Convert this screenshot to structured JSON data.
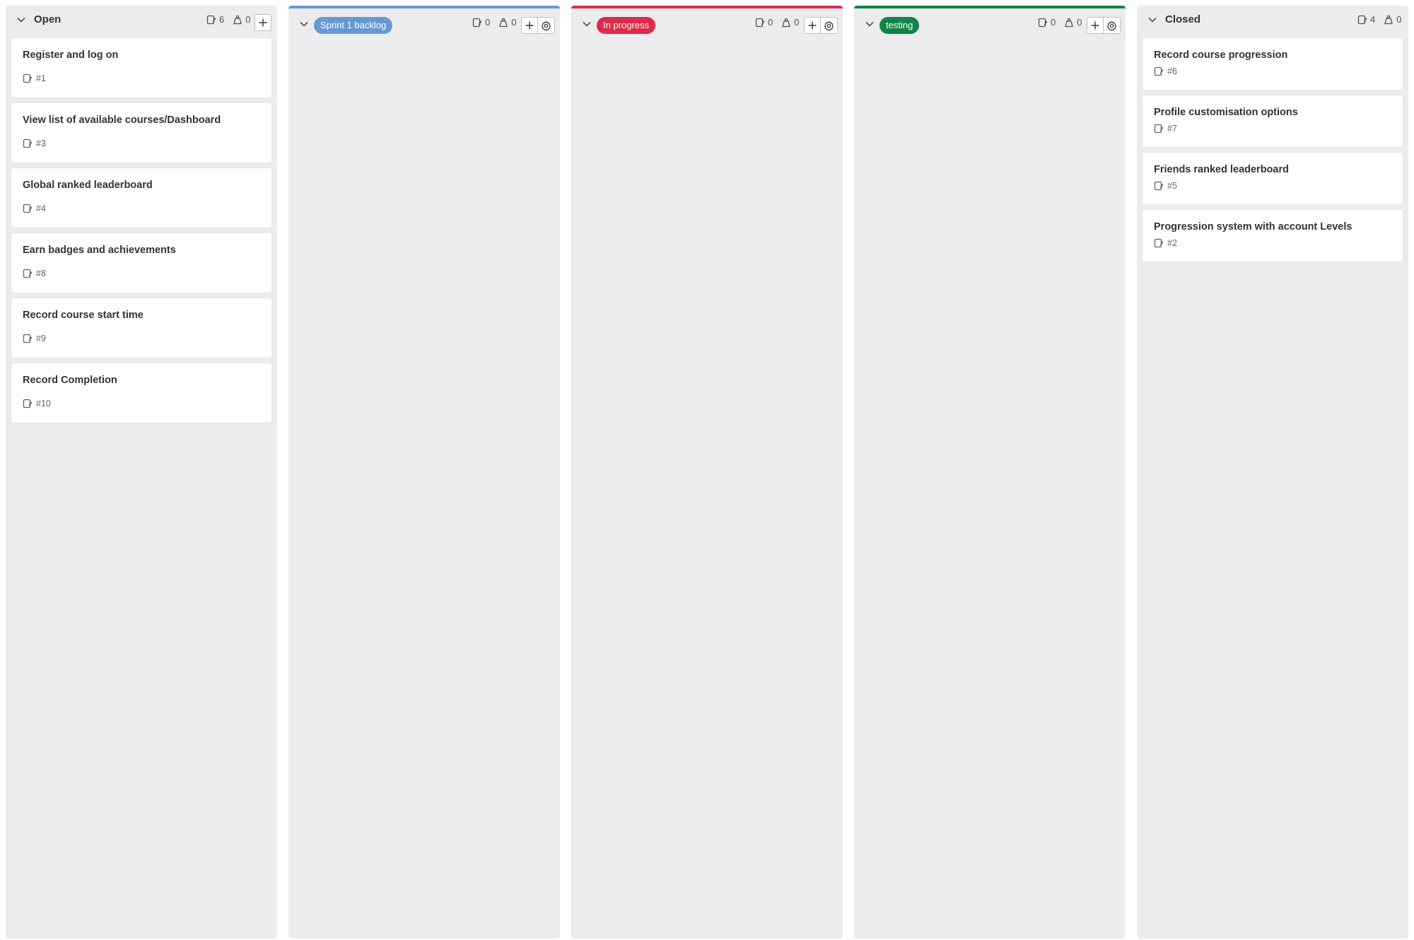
{
  "columns": {
    "open": {
      "title": "Open",
      "issue_count": "6",
      "weight": "0",
      "cards": [
        {
          "title": "Register and log on",
          "ref": "#1"
        },
        {
          "title": "View list of available courses/Dashboard",
          "ref": "#3"
        },
        {
          "title": "Global ranked leaderboard",
          "ref": "#4"
        },
        {
          "title": "Earn badges and achievements",
          "ref": "#8"
        },
        {
          "title": "Record course start time",
          "ref": "#9"
        },
        {
          "title": "Record Completion",
          "ref": "#10"
        }
      ]
    },
    "sprint": {
      "title": "Sprint 1 backlog",
      "color": "#6699d4",
      "issue_count": "0",
      "weight": "0"
    },
    "progress": {
      "title": "In progress",
      "color": "#dd2b4b",
      "issue_count": "0",
      "weight": "0"
    },
    "testing": {
      "title": "testing",
      "color": "#108548",
      "issue_count": "0",
      "weight": "0"
    },
    "closed": {
      "title": "Closed",
      "issue_count": "4",
      "weight": "0",
      "cards": [
        {
          "title": "Record course progression",
          "ref": "#6"
        },
        {
          "title": "Profile customisation options",
          "ref": "#7"
        },
        {
          "title": "Friends ranked leaderboard",
          "ref": "#5"
        },
        {
          "title": "Progression system with account Levels",
          "ref": "#2"
        }
      ]
    }
  },
  "icons": {
    "collapse": "chevron-down-icon",
    "issues": "issues-icon",
    "weight": "weight-icon",
    "add": "plus-icon",
    "settings": "gear-icon"
  }
}
